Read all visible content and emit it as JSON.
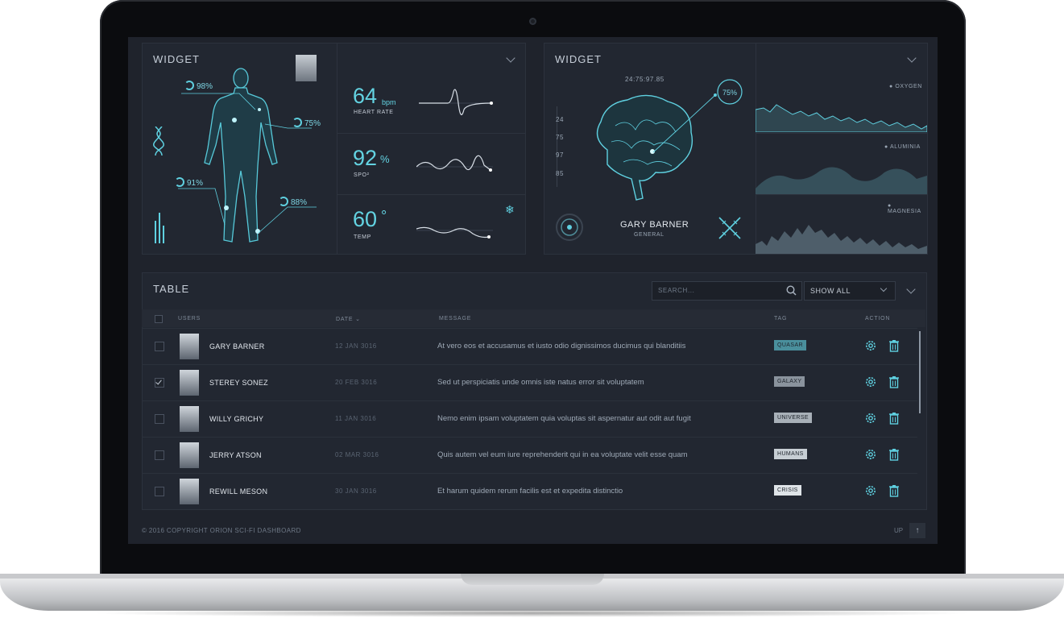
{
  "vitals": {
    "title": "WIDGET",
    "body_pcts": [
      "98%",
      "75%",
      "91%",
      "88%"
    ],
    "metrics": [
      {
        "value": "64",
        "unit": "bpm",
        "label": "HEART RATE"
      },
      {
        "value": "92",
        "unit": "%",
        "label": "SPO²"
      },
      {
        "value": "60",
        "unit": "°",
        "label": "TEMP"
      }
    ]
  },
  "brain": {
    "title": "WIDGET",
    "timer": "24:75:97.85",
    "scale": [
      "24",
      "75",
      "97",
      "85"
    ],
    "pct": "75%",
    "person_name": "GARY BARNER",
    "person_role": "GENERAL",
    "charts": [
      "OXYGEN",
      "ALUMINIA",
      "MAGNESIA"
    ]
  },
  "table": {
    "title": "TABLE",
    "search_placeholder": "SEARCH...",
    "filter_value": "SHOW ALL",
    "columns": {
      "users": "USERS",
      "date": "DATE",
      "message": "MESSAGE",
      "tag": "TAG",
      "action": "ACTION"
    },
    "rows": [
      {
        "name": "GARY BARNER",
        "date": "12 JAN 3016",
        "message": "At vero eos et accusamus et iusto odio dignissimos ducimus qui blanditiis",
        "tag": "QUASAR",
        "tag_color": "#4a8f9c",
        "checked": false
      },
      {
        "name": "STEREY SONEZ",
        "date": "20 FEB 3016",
        "message": "Sed ut perspiciatis unde omnis iste natus error sit voluptatem",
        "tag": "GALAXY",
        "tag_color": "#8a939d",
        "checked": true
      },
      {
        "name": "WILLY GRICHY",
        "date": "11 JAN 3016",
        "message": "Nemo enim ipsam voluptatem quia voluptas sit aspernatur aut odit aut fugit",
        "tag": "UNIVERSE",
        "tag_color": "#a8b0b8",
        "checked": false
      },
      {
        "name": "JERRY ATSON",
        "date": "02 MAR 3016",
        "message": "Quis autem vel eum iure reprehenderit qui in ea voluptate velit esse quam",
        "tag": "HUMANS",
        "tag_color": "#c7ced4",
        "checked": false
      },
      {
        "name": "REWILL MESON",
        "date": "30 JAN 3016",
        "message": "Et harum quidem rerum facilis est et expedita distinctio",
        "tag": "CRISIS",
        "tag_color": "#dfe4e8",
        "checked": false
      }
    ]
  },
  "footer": {
    "copyright": "© 2016 COPYRIGHT ORION SCI-FI DASHBOARD",
    "up_label": "UP",
    "up_icon": "↑"
  },
  "colors": {
    "accent": "#5fd0e0",
    "background": "#1f232c",
    "panel": "#222731"
  }
}
